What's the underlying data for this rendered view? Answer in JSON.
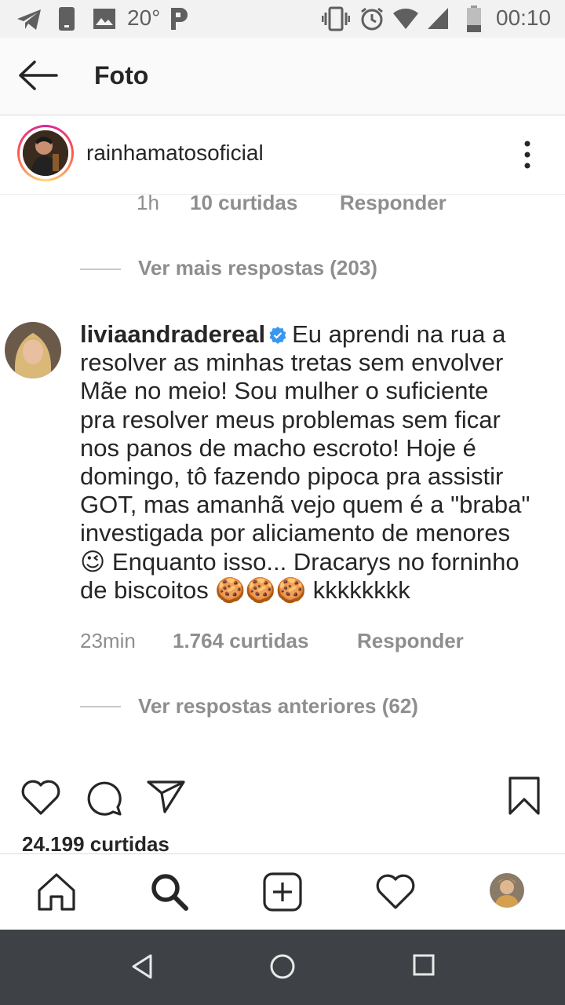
{
  "status_bar": {
    "temperature": "20°",
    "time": "00:10",
    "icons": [
      "telegram-icon",
      "phone-icon",
      "image-icon",
      "parking-icon",
      "vibrate-icon",
      "alarm-icon",
      "wifi-icon",
      "signal-icon",
      "battery-icon"
    ]
  },
  "app_bar": {
    "title": "Foto",
    "back_icon": "arrow-left-icon"
  },
  "post": {
    "username": "rainhamatosoficial",
    "menu_icon": "more-vertical-icon",
    "likes": "24.199 curtidas"
  },
  "prev_reply": {
    "time": "1h",
    "likes": "10 curtidas",
    "reply": "Responder"
  },
  "view_more": "Ver mais respostas (203)",
  "comment": {
    "username": "liviaandradereal",
    "verified": true,
    "lines": [
      "Eu aprendi na rua a",
      "resolver as minhas tretas sem envolver",
      "Mãe no meio! Sou mulher o suficiente",
      "pra resolver meus problemas sem ficar",
      "nos panos de macho escroto! Hoje é",
      "domingo, tô fazendo pipoca pra assistir",
      "GOT, mas amanhã vejo quem é a \"braba\"",
      "investigada por aliciamento de menores",
      "😉 Enquanto isso... Dracarys no forninho",
      "de biscoitos 🍪🍪🍪 kkkkkkkk"
    ],
    "time": "23min",
    "likes": "1.764 curtidas",
    "reply": "Responder"
  },
  "view_previous": "Ver respostas anteriores (62)",
  "tab_bar": {
    "icons": [
      "home-icon",
      "search-icon",
      "add-post-icon",
      "activity-heart-icon",
      "profile-avatar"
    ]
  },
  "nav_bar": {
    "icons": [
      "back-triangle-icon",
      "home-circle-icon",
      "recents-square-icon"
    ]
  },
  "colors": {
    "verified": "#3897f0",
    "muted": "#8e8e8e",
    "text": "#262626",
    "nav_bg": "#3e4246"
  }
}
